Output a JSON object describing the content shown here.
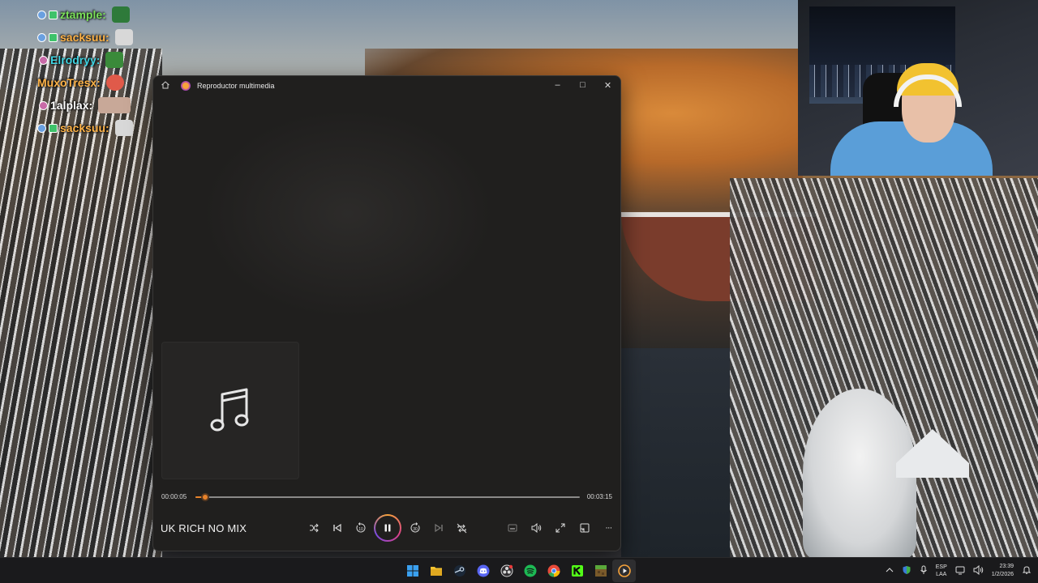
{
  "chat": {
    "messages": [
      {
        "user": "ztample:",
        "color": "#7be05a"
      },
      {
        "user": "sacksuu:",
        "color": "#ffb347"
      },
      {
        "user": "Elrodryy:",
        "color": "#3ed2e0"
      },
      {
        "user": "MuxoTresx:",
        "color": "#ffb347"
      },
      {
        "user": "1alplax:",
        "color": "#ffffff"
      },
      {
        "user": "sacksuu:",
        "color": "#ffb347"
      }
    ]
  },
  "player": {
    "app_title": "Reproductor multimedia",
    "track_title": "UK RICH NO MIX",
    "time_current": "00:00:05",
    "time_total": "00:03:15",
    "progress": 0.0256,
    "accent": "#e8822a",
    "window_controls": {
      "minimize": "–",
      "maximize": "□",
      "close": "✕"
    },
    "icons": {
      "home": "home-icon",
      "album_art": "music-note-icon",
      "shuffle": "shuffle-icon",
      "previous": "previous-icon",
      "rewind": "rewind-10-icon",
      "play_pause": "pause-icon",
      "forward": "forward-30-icon",
      "next": "next-icon",
      "repeat": "repeat-off-icon",
      "miniplayer": "miniplayer-icon",
      "volume": "volume-icon",
      "fullscreen": "fullscreen-icon",
      "cast": "cast-icon",
      "more": "more-icon"
    },
    "rewind_label": "10",
    "forward_label": "30",
    "more_label": "···"
  },
  "taskbar": {
    "apps": [
      {
        "name": "start-icon",
        "color": "#3aa0f0"
      },
      {
        "name": "file-explorer-icon",
        "color": "#f2c230"
      },
      {
        "name": "steam-icon",
        "color": "#c8d8e8"
      },
      {
        "name": "discord-icon",
        "color": "#5865f2"
      },
      {
        "name": "obs-icon",
        "color": "#d8d8d8"
      },
      {
        "name": "spotify-icon",
        "color": "#1db954"
      },
      {
        "name": "chrome-icon",
        "color": "#e84a3a"
      },
      {
        "name": "kick-icon",
        "color": "#53fc18"
      },
      {
        "name": "minecraft-icon",
        "color": "#7a5a2a"
      },
      {
        "name": "media-player-icon",
        "color": "#f7a33a"
      }
    ],
    "lang_top": "ESP",
    "lang_bottom": "LAA",
    "clock_time": "23:39",
    "clock_date": "1/2/2026"
  }
}
